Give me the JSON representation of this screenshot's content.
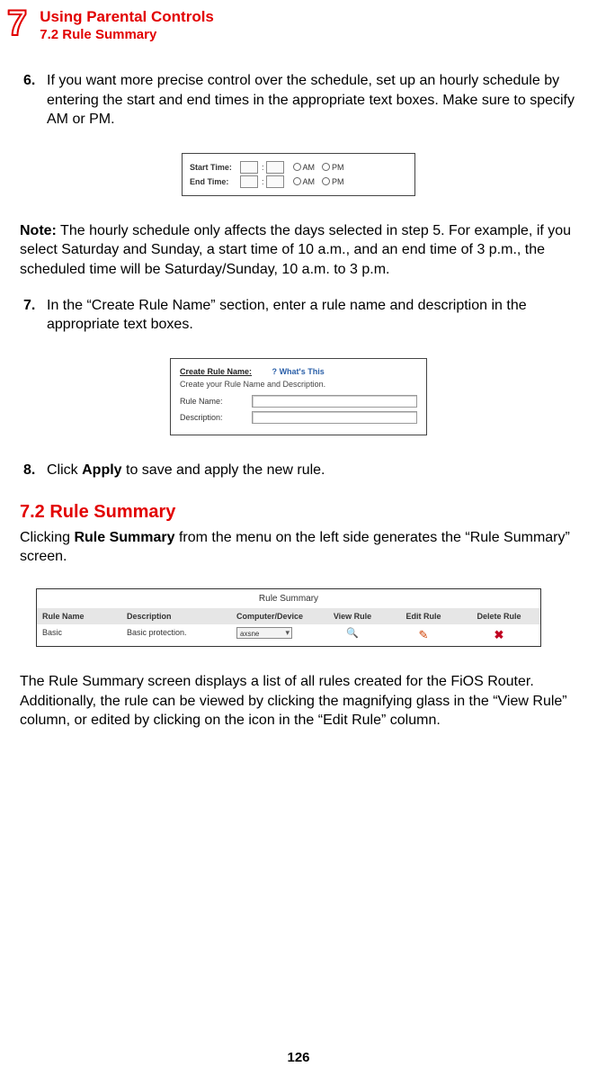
{
  "header": {
    "chapter_number": "7",
    "title": "Using Parental Controls",
    "subtitle": "7.2  Rule Summary"
  },
  "step6": {
    "num": "6.",
    "text": "If you want more precise control over the schedule, set up an hourly schedule by entering the start and end times in the appropriate text boxes. Make sure to specify AM or PM."
  },
  "fig1": {
    "start_label": "Start Time:",
    "end_label": "End Time:",
    "am": "AM",
    "pm": "PM"
  },
  "note": {
    "label": "Note:",
    "text": " The hourly schedule only affects the days selected in step 5. For example, if you select Saturday and Sunday, a start time of 10 a.m., and an end time of 3 p.m., the scheduled time will be Saturday/Sunday, 10 a.m. to 3 p.m."
  },
  "step7": {
    "num": "7.",
    "text": "In the “Create Rule Name” section, enter a rule name and description in the appropriate text boxes."
  },
  "fig2": {
    "section_title": "Create Rule Name:",
    "whats_this": "What's This",
    "subtext": "Create your Rule Name and Description.",
    "name_label": "Rule Name:",
    "desc_label": "Description:"
  },
  "step8": {
    "num": "8.",
    "pre": "Click ",
    "bold": "Apply",
    "post": " to save and apply the new rule."
  },
  "section": {
    "heading": "7.2  Rule Summary",
    "intro_pre": "Clicking ",
    "intro_bold": "Rule Summary",
    "intro_post": " from the menu on the left side generates the “Rule Summary” screen."
  },
  "fig3": {
    "title": "Rule Summary",
    "cols": {
      "c1": "Rule Name",
      "c2": "Description",
      "c3": "Computer/Device",
      "c4": "View Rule",
      "c5": "Edit Rule",
      "c6": "Delete Rule"
    },
    "row": {
      "name": "Basic",
      "desc": "Basic protection.",
      "device": "axsne"
    }
  },
  "outro": "The Rule Summary screen displays a list of all rules created for the FiOS Router. Additionally, the rule can be viewed by clicking the magnifying glass in the “View Rule” column, or edited by clicking on the icon in the “Edit Rule” column.",
  "page_number": "126"
}
